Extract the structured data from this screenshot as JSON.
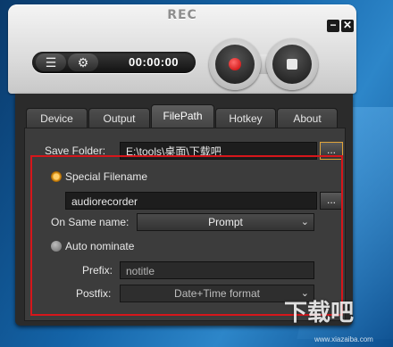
{
  "app": {
    "title": "REC",
    "minimize_glyph": "−",
    "close_glyph": "✕"
  },
  "controls": {
    "list_icon": "list-icon",
    "gear_icon": "gear-icon",
    "timer": "00:00:00"
  },
  "tabs": [
    {
      "label": "Device"
    },
    {
      "label": "Output"
    },
    {
      "label": "FilePath",
      "active": true
    },
    {
      "label": "Hotkey"
    },
    {
      "label": "About"
    }
  ],
  "filepath": {
    "save_folder_label": "Save Folder:",
    "save_folder_value": "E:\\tools\\桌面\\下载吧",
    "browse_label": "...",
    "special_filename_label": "Special Filename",
    "special_filename_value": "audiorecorder",
    "browse2_label": "...",
    "on_same_name_label": "On Same name:",
    "on_same_name_value": "Prompt",
    "auto_nominate_label": "Auto nominate",
    "prefix_label": "Prefix:",
    "prefix_value": "notitle",
    "postfix_label": "Postfix:",
    "postfix_value": "Date+Time format"
  },
  "watermark": {
    "text": "下载吧",
    "sub": "www.xiazaiba.com"
  },
  "colors": {
    "highlight_box": "#d6161b",
    "radio_active": "#e39a1e"
  }
}
